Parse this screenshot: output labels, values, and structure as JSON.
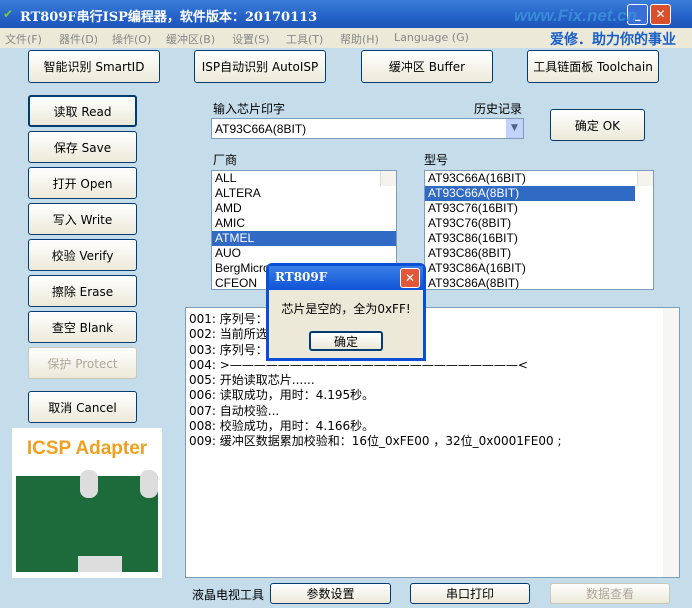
{
  "window": {
    "title": "RT809F串行ISP编程器，软件版本：20170113",
    "brand_url": "www.Fix.net.cn",
    "brand_slogan": "爱修．助力你的事业"
  },
  "menu": [
    "文件(F)",
    "器件(D)",
    "操作(O)",
    "缓冲区(B)",
    "设置(S)",
    "工具(T)",
    "帮助(H)",
    "Language (G)"
  ],
  "top_buttons": [
    "智能识别 SmartID",
    "ISP自动识别 AutoISP",
    "缓冲区 Buffer",
    "工具链面板 Toolchain"
  ],
  "left_buttons": [
    "读取 Read",
    "保存 Save",
    "打开 Open",
    "写入 Write",
    "校验 Verify",
    "擦除 Erase",
    "查空 Blank",
    "保护 Protect",
    "取消 Cancel"
  ],
  "chip_input": {
    "label": "输入芯片印字",
    "history_label": "历史记录",
    "value": "AT93C66A(8BIT)",
    "ok": "确定 OK"
  },
  "vendor": {
    "label": "厂商",
    "items": [
      "ALL",
      "ALTERA",
      "AMD",
      "AMIC",
      "ATMEL",
      "AUO",
      "BergMicro",
      "CFEON"
    ],
    "selected": 4
  },
  "model": {
    "label": "型号",
    "items": [
      "AT93C66A(16BIT)",
      "AT93C66A(8BIT)",
      "AT93C76(16BIT)",
      "AT93C76(8BIT)",
      "AT93C86(16BIT)",
      "AT93C86(8BIT)",
      "AT93C86A(16BIT)",
      "AT93C86A(8BIT)"
    ],
    "selected": 1
  },
  "log": [
    "001: 序列号：",
    "002: 当前所选                              X位，512字节。",
    "003: 序列号：                            编程器固件版本：V1.0 。",
    "004: >————————————————————————<",
    "005: 开始读取芯片......",
    "006: 读取成功，用时：4.195秒。",
    "007: 自动校验...",
    "008: 校验成功，用时：4.166秒。",
    "009: 缓冲区数据累加校验和：16位_0xFE00 ，32位_0x0001FE00 ;"
  ],
  "dialog": {
    "title": "RT809F",
    "message": "芯片是空的，全为0xFF!",
    "ok": "确定"
  },
  "adapter": {
    "title": "ICSP Adapter"
  },
  "bottom": {
    "label": "液晶电视工具",
    "buttons": [
      "参数设置",
      "串口打印",
      "数据查看"
    ]
  }
}
